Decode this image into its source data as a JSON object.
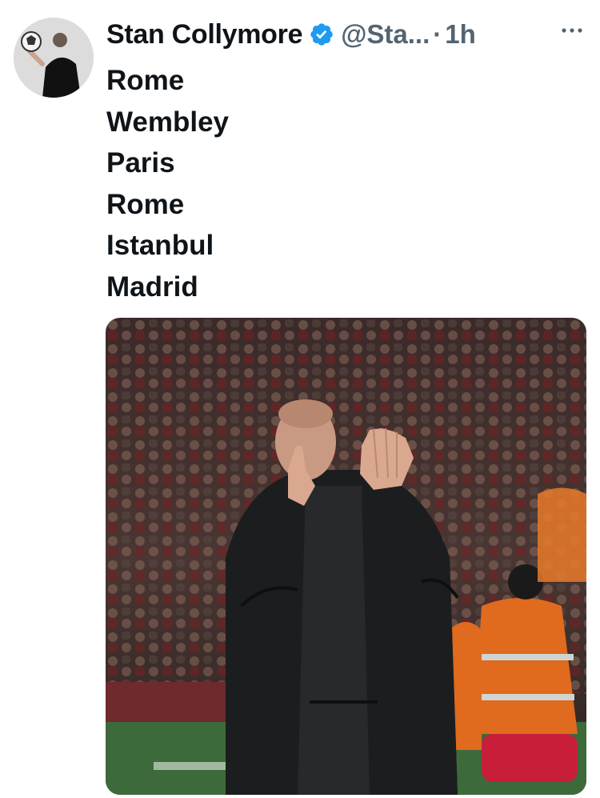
{
  "tweet": {
    "author_name": "Stan Collymore",
    "author_handle": "@Sta...",
    "separator": "·",
    "time": "1h",
    "lines": [
      "Rome",
      "Wembley",
      "Paris",
      "Rome",
      "Istanbul",
      "Madrid"
    ]
  },
  "icons": {
    "verified": "verified-badge-icon",
    "more": "more-options-icon"
  },
  "colors": {
    "verified_blue": "#1d9bf0",
    "muted_text": "#536471",
    "text": "#0f1419"
  }
}
